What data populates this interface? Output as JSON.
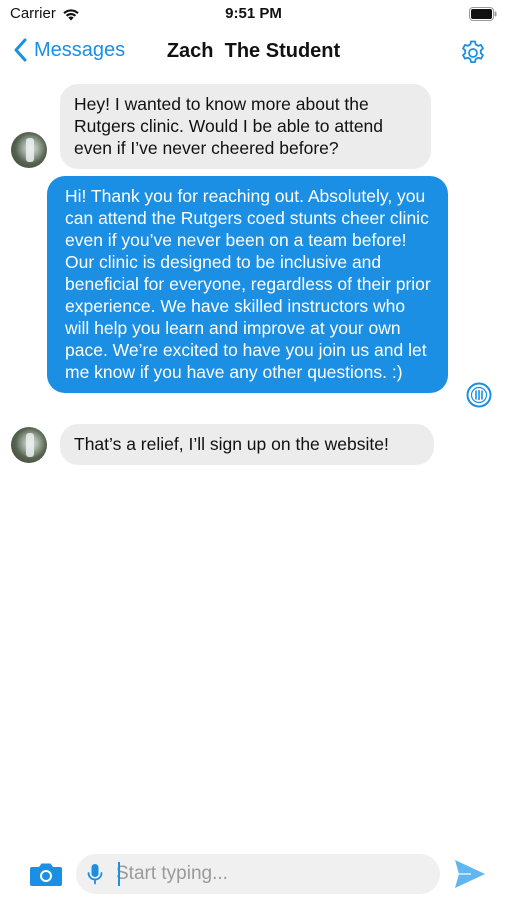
{
  "status_bar": {
    "carrier": "Carrier",
    "time": "9:51 PM"
  },
  "nav": {
    "back_label": "Messages",
    "title": "Zach  The Student"
  },
  "messages": [
    {
      "direction": "incoming",
      "text": "Hey! I wanted to know more about the Rutgers clinic. Would I be able to attend even if I’ve never cheered before?"
    },
    {
      "direction": "outgoing",
      "text": "Hi! Thank you for reaching out. Absolutely, you can attend the Rutgers coed stunts cheer clinic even if you’ve never been on a team before! Our clinic is designed to be inclusive and beneficial for everyone, regardless of their prior experience. We have skilled instructors who will help you learn and improve at your own pace. We’re excited to have you join us and let me know if you have any other questions. :)"
    },
    {
      "direction": "incoming",
      "text": "That’s a relief, I’ll sign up on the website!"
    }
  ],
  "composer": {
    "placeholder": "Start typing...",
    "value": ""
  },
  "colors": {
    "accent": "#1a8fe3",
    "incoming_bubble": "#ececec",
    "outgoing_bubble": "#1a8fe3"
  },
  "icons": {
    "wifi": "wifi-icon",
    "battery": "battery-icon",
    "back": "chevron-left-icon",
    "settings": "gear-icon",
    "camera": "camera-icon",
    "mic": "mic-icon",
    "send": "send-icon"
  }
}
